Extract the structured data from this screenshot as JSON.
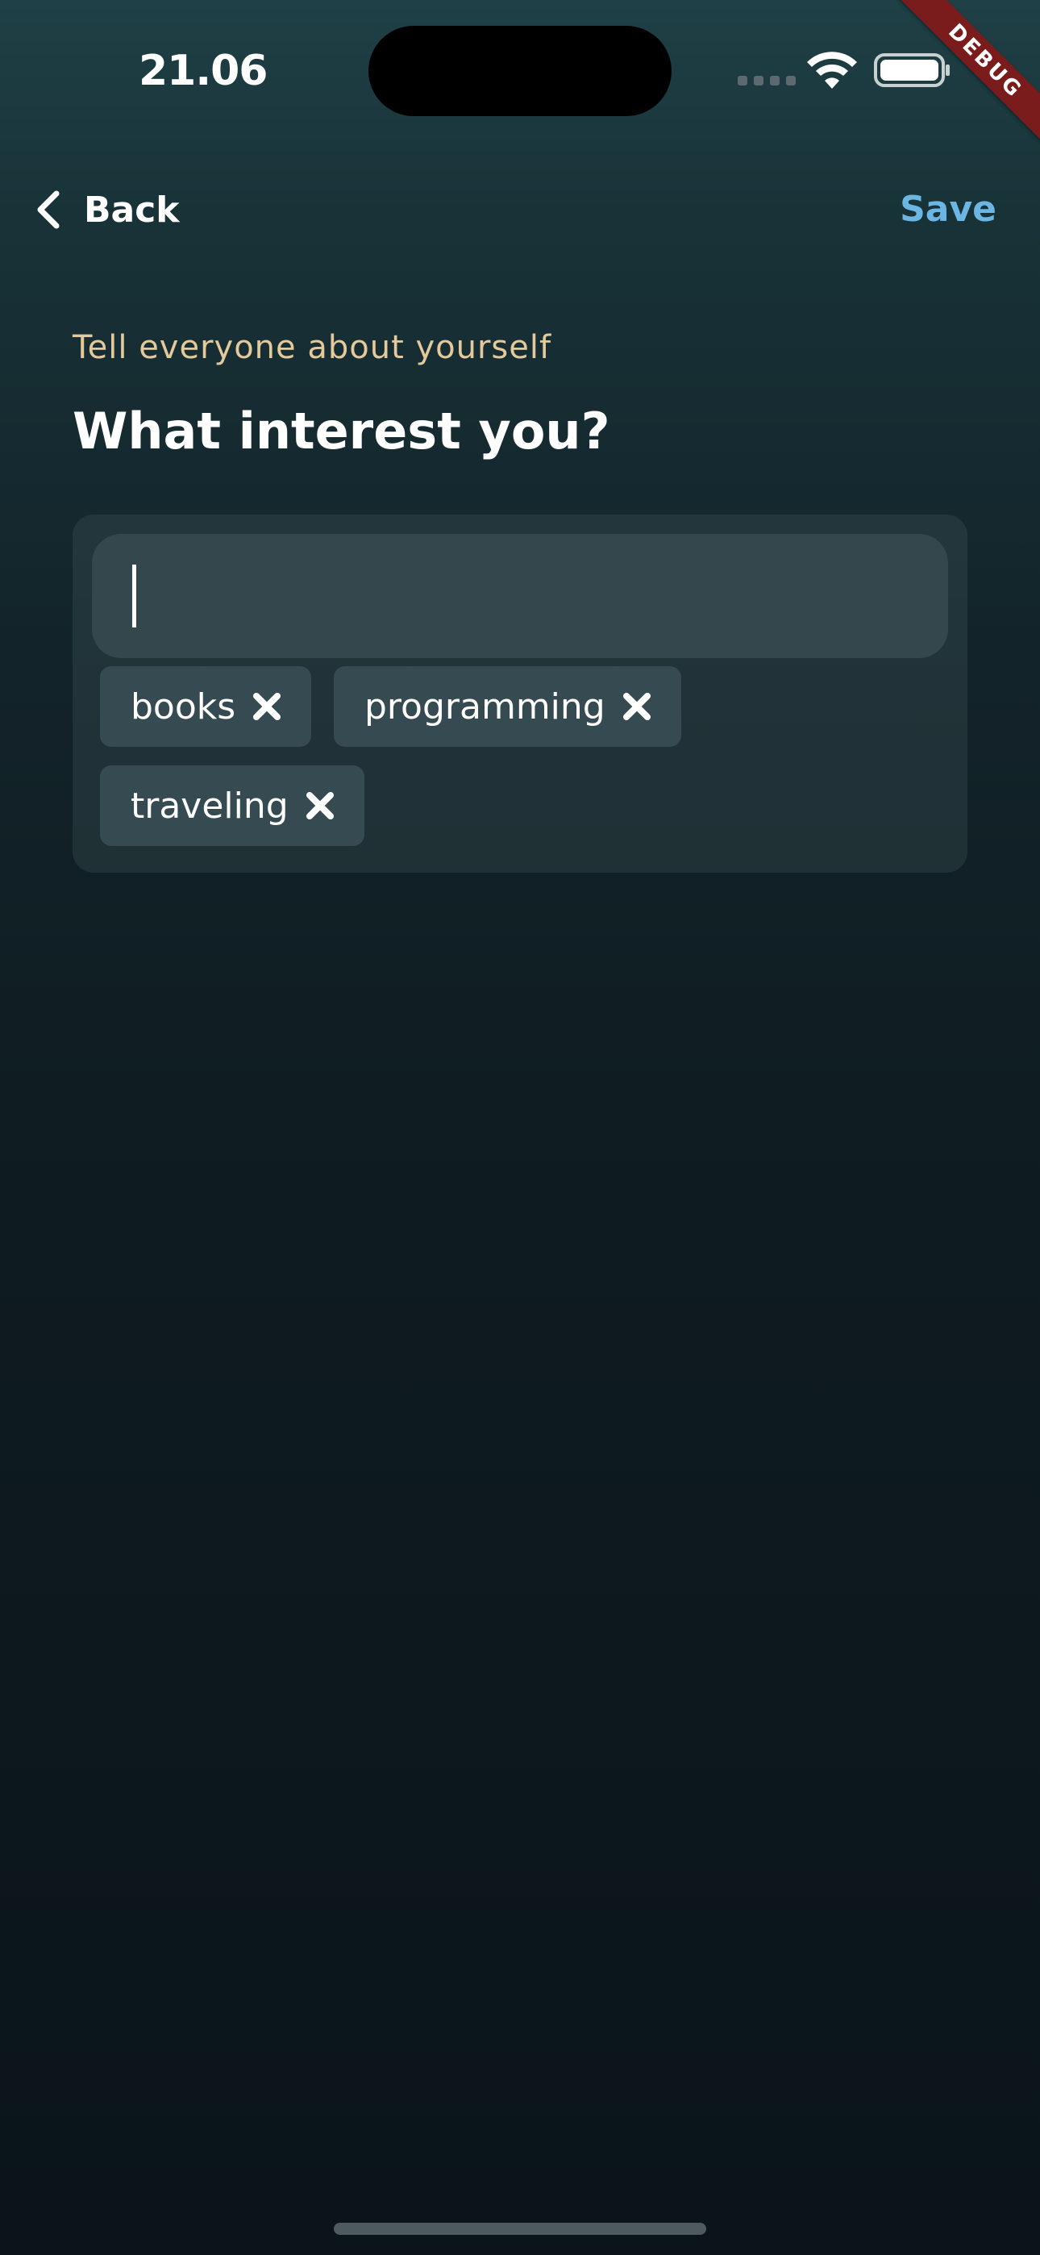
{
  "status_bar": {
    "time": "21.06"
  },
  "debug_banner": {
    "label": "DEBUG"
  },
  "nav": {
    "back_label": "Back",
    "save_label": "Save",
    "back_icon": "chevron-left-icon"
  },
  "content": {
    "subtitle": "Tell everyone about yourself",
    "title": "What interest you?"
  },
  "interest_input": {
    "value": "",
    "focused": true
  },
  "interests": [
    {
      "label": "books",
      "remove_icon": "close-icon"
    },
    {
      "label": "programming",
      "remove_icon": "close-icon"
    },
    {
      "label": "traveling",
      "remove_icon": "close-icon"
    }
  ],
  "colors": {
    "accent_save": "#6cb6e4",
    "subtitle": "#e4c99a",
    "chip_background": "#364a51",
    "input_background": "#33474d",
    "debug_ribbon": "#7a1c1c"
  }
}
